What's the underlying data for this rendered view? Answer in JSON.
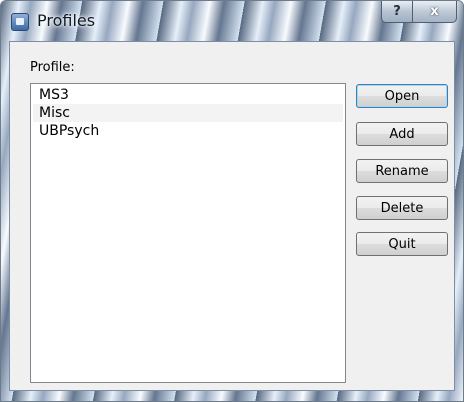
{
  "window": {
    "title": "Profiles",
    "help_label": "?",
    "close_label": "x"
  },
  "profile": {
    "label": "Profile:",
    "items": [
      "MS3",
      "Misc",
      "UBPsych"
    ],
    "selected": "Misc"
  },
  "buttons": {
    "open": "Open",
    "add": "Add",
    "rename": "Rename",
    "delete": "Delete",
    "quit": "Quit"
  },
  "colors": {
    "default_button_border": "#3c7fb1",
    "client_background": "#f0f0f0"
  },
  "icons": {
    "app": "profiles-app-icon",
    "help": "question-mark-icon",
    "close": "close-x-icon"
  }
}
